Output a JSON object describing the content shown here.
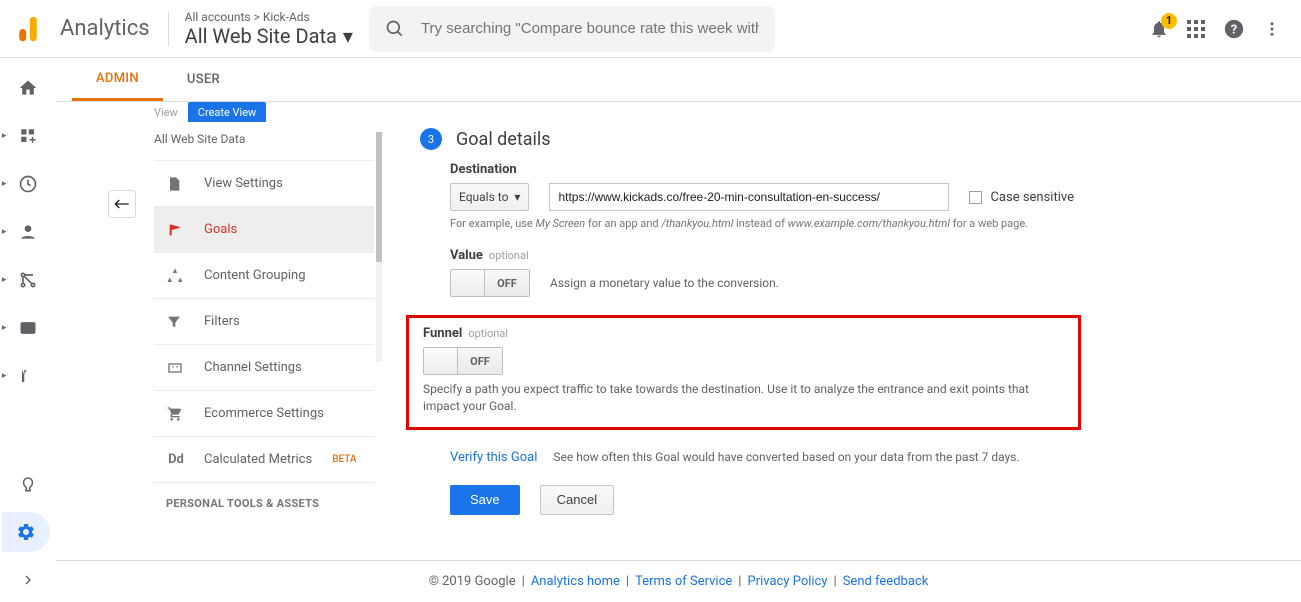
{
  "header": {
    "product": "Analytics",
    "breadcrumb": "All accounts > Kick-Ads",
    "view_name": "All Web Site Data",
    "search_placeholder": "Try searching \"Compare bounce rate this week with last week\"",
    "notif_count": "1"
  },
  "tabs": {
    "admin": "ADMIN",
    "user": "USER"
  },
  "sidebar": {
    "view_label": "View",
    "create_view": "Create View",
    "dataset": "All Web Site Data",
    "items": [
      {
        "label": "View Settings"
      },
      {
        "label": "Goals"
      },
      {
        "label": "Content Grouping"
      },
      {
        "label": "Filters"
      },
      {
        "label": "Channel Settings"
      },
      {
        "label": "Ecommerce Settings"
      },
      {
        "label": "Calculated Metrics",
        "beta": "BETA"
      }
    ],
    "section1": "PERSONAL TOOLS & ASSETS"
  },
  "goal": {
    "step_num": "3",
    "step_title": "Goal details",
    "destination": {
      "label": "Destination",
      "match": "Equals to",
      "url": "https://www.kickads.co/free-20-min-consultation-en-success/",
      "case": "Case sensitive",
      "hint_pre": "For example, use ",
      "hint_i1": "My Screen",
      "hint_mid1": " for an app and ",
      "hint_i2": "/thankyou.html",
      "hint_mid2": " instead of ",
      "hint_i3": "www.example.com/thankyou.html",
      "hint_post": " for a web page."
    },
    "value": {
      "label": "Value",
      "optional": "optional",
      "state": "OFF",
      "desc": "Assign a monetary value to the conversion."
    },
    "funnel": {
      "label": "Funnel",
      "optional": "optional",
      "state": "OFF",
      "desc": "Specify a path you expect traffic to take towards the destination. Use it to analyze the entrance and exit points that impact your Goal."
    },
    "verify": {
      "link": "Verify this Goal",
      "desc": "See how often this Goal would have converted based on your data from the past 7 days."
    },
    "save": "Save",
    "cancel": "Cancel"
  },
  "footer": {
    "copy": "© 2019 Google",
    "home": "Analytics home",
    "tos": "Terms of Service",
    "privacy": "Privacy Policy",
    "feedback": "Send feedback"
  }
}
